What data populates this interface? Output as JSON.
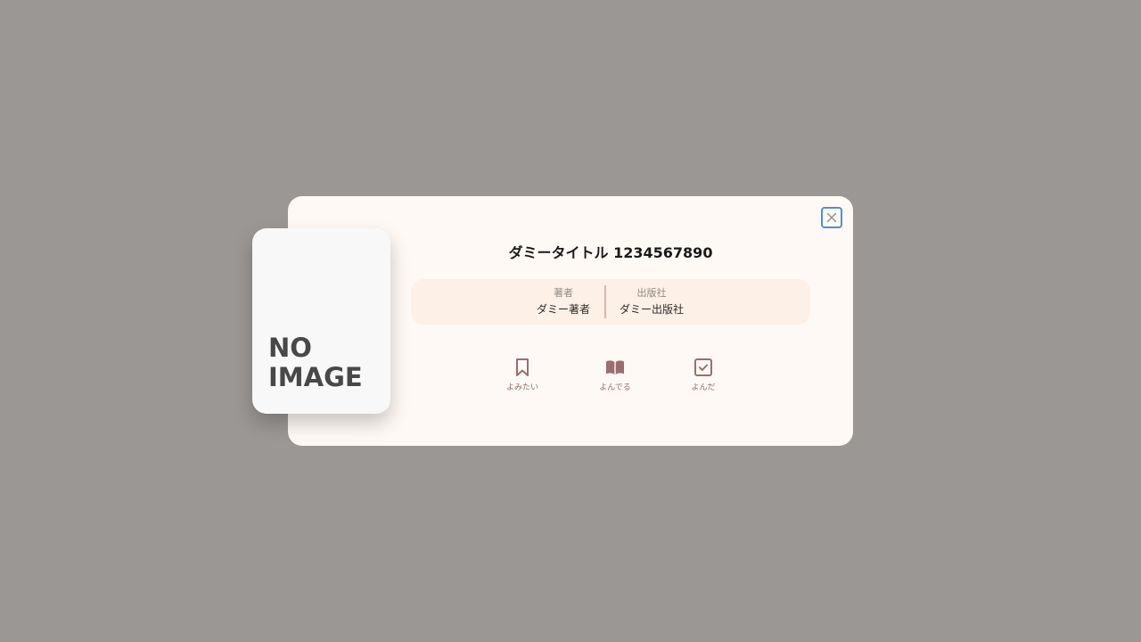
{
  "book": {
    "title": "ダミータイトル 1234567890",
    "cover_line1": "NO",
    "cover_line2": "IMAGE",
    "author_label": "著者",
    "author_value": "ダミー著者",
    "publisher_label": "出版社",
    "publisher_value": "ダミー出版社"
  },
  "actions": {
    "want_label": "よみたい",
    "reading_label": "よんでる",
    "read_label": "よんだ"
  },
  "icons": {
    "close": "close-icon",
    "want": "bookmark-icon",
    "reading": "open-book-icon",
    "read": "checkbox-icon"
  },
  "colors": {
    "backdrop": "#9b9794",
    "modal_bg": "#fff9f5",
    "meta_bg": "#fdf0e6",
    "icon": "#9a6e6c",
    "close_border": "#4a90d9"
  }
}
